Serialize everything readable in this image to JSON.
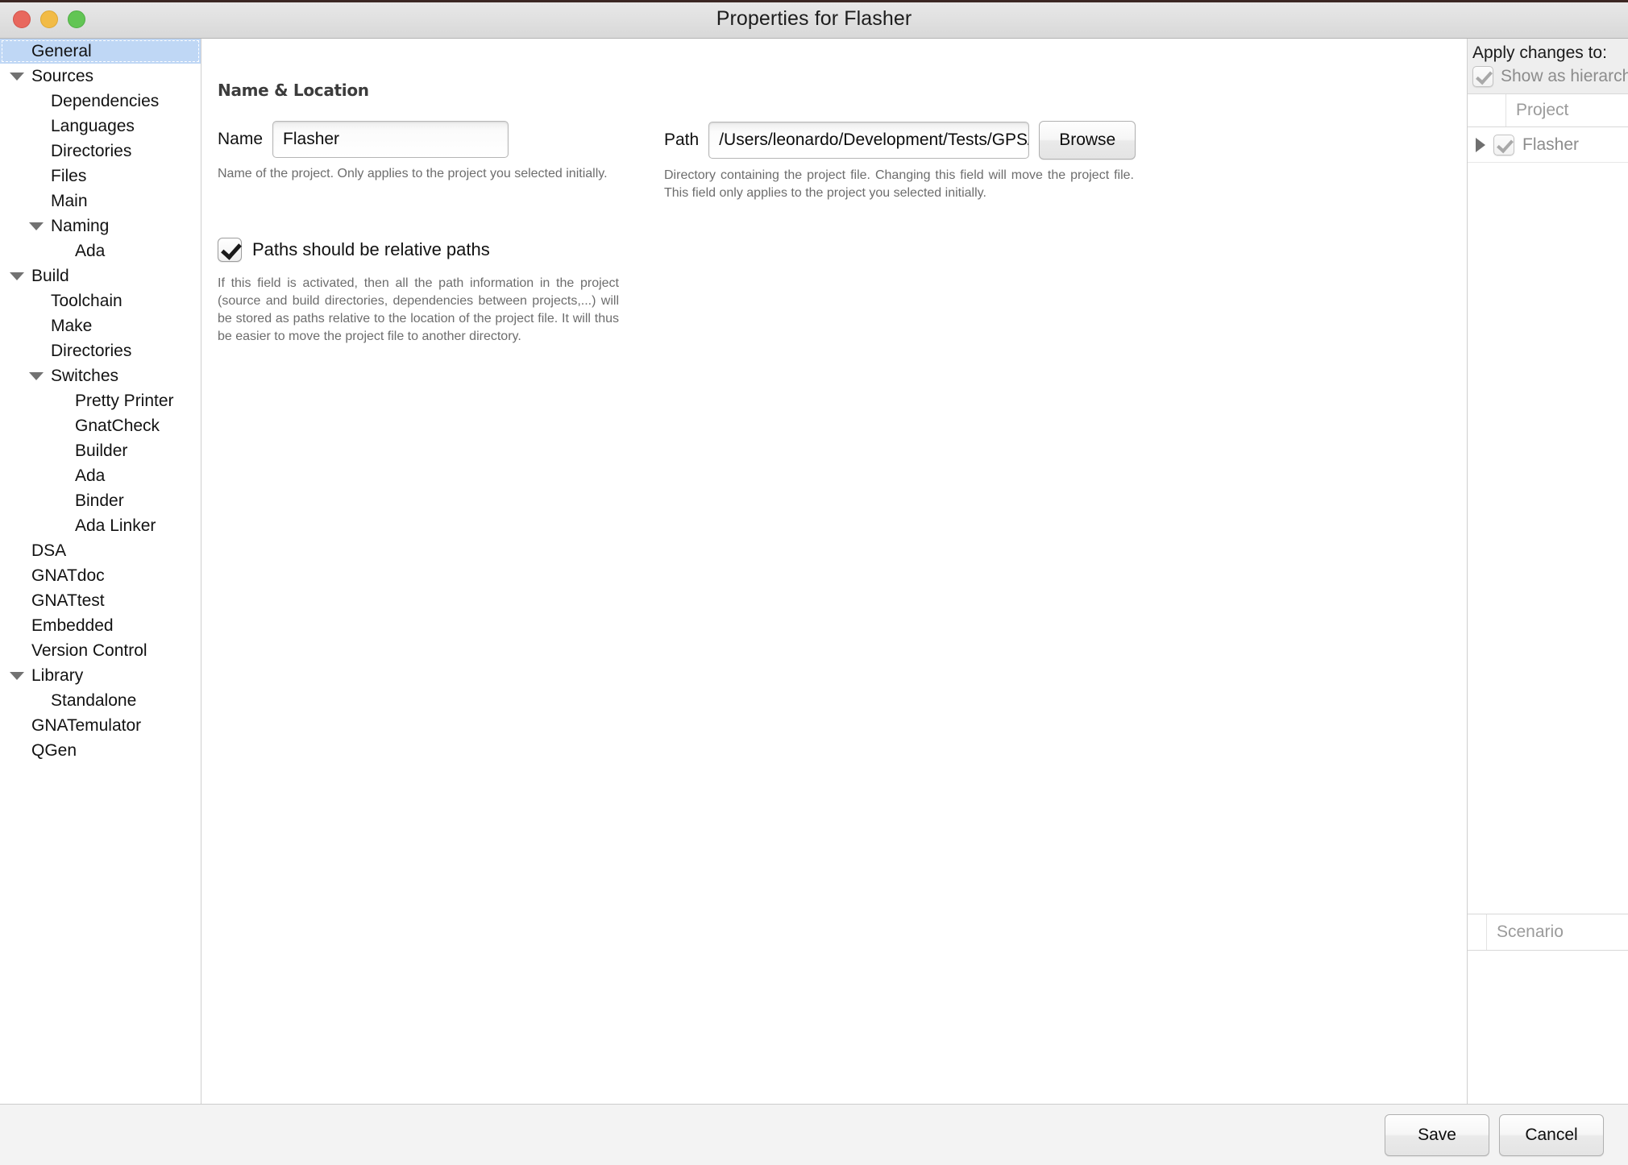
{
  "window": {
    "title": "Properties for Flasher",
    "traffic_lights": [
      "close",
      "minimize",
      "maximize"
    ]
  },
  "sidebar": {
    "items": [
      {
        "label": "General",
        "level": 0,
        "twisty": "none",
        "selected": true
      },
      {
        "label": "Sources",
        "level": 0,
        "twisty": "expanded",
        "selected": false
      },
      {
        "label": "Dependencies",
        "level": 1,
        "twisty": "none",
        "selected": false
      },
      {
        "label": "Languages",
        "level": 1,
        "twisty": "none",
        "selected": false
      },
      {
        "label": "Directories",
        "level": 1,
        "twisty": "none",
        "selected": false
      },
      {
        "label": "Files",
        "level": 1,
        "twisty": "none",
        "selected": false
      },
      {
        "label": "Main",
        "level": 1,
        "twisty": "none",
        "selected": false
      },
      {
        "label": "Naming",
        "level": 1,
        "twisty": "expanded",
        "selected": false
      },
      {
        "label": "Ada",
        "level": 2,
        "twisty": "none",
        "selected": false
      },
      {
        "label": "Build",
        "level": 0,
        "twisty": "expanded",
        "selected": false
      },
      {
        "label": "Toolchain",
        "level": 1,
        "twisty": "none",
        "selected": false
      },
      {
        "label": "Make",
        "level": 1,
        "twisty": "none",
        "selected": false
      },
      {
        "label": "Directories",
        "level": 1,
        "twisty": "none",
        "selected": false
      },
      {
        "label": "Switches",
        "level": 1,
        "twisty": "expanded",
        "selected": false
      },
      {
        "label": "Pretty Printer",
        "level": 2,
        "twisty": "none",
        "selected": false
      },
      {
        "label": "GnatCheck",
        "level": 2,
        "twisty": "none",
        "selected": false
      },
      {
        "label": "Builder",
        "level": 2,
        "twisty": "none",
        "selected": false
      },
      {
        "label": "Ada",
        "level": 2,
        "twisty": "none",
        "selected": false
      },
      {
        "label": "Binder",
        "level": 2,
        "twisty": "none",
        "selected": false
      },
      {
        "label": "Ada Linker",
        "level": 2,
        "twisty": "none",
        "selected": false
      },
      {
        "label": "DSA",
        "level": 0,
        "twisty": "none",
        "selected": false
      },
      {
        "label": "GNATdoc",
        "level": 0,
        "twisty": "none",
        "selected": false
      },
      {
        "label": "GNATtest",
        "level": 0,
        "twisty": "none",
        "selected": false
      },
      {
        "label": "Embedded",
        "level": 0,
        "twisty": "none",
        "selected": false
      },
      {
        "label": "Version Control",
        "level": 0,
        "twisty": "none",
        "selected": false
      },
      {
        "label": "Library",
        "level": 0,
        "twisty": "expanded",
        "selected": false
      },
      {
        "label": "Standalone",
        "level": 1,
        "twisty": "none",
        "selected": false
      },
      {
        "label": "GNATemulator",
        "level": 0,
        "twisty": "none",
        "selected": false
      },
      {
        "label": "QGen",
        "level": 0,
        "twisty": "none",
        "selected": false
      }
    ]
  },
  "main": {
    "section_title": "Name & Location",
    "name_field": {
      "label": "Name",
      "value": "Flasher",
      "hint": "Name of the project. Only applies to the project you selected initially."
    },
    "path_field": {
      "label": "Path",
      "value": "/Users/leonardo/Development/Tests/GPS/Lé",
      "browse_label": "Browse",
      "hint": "Directory containing the project file. Changing this field will move the project file. This field only applies to the project you selected initially."
    },
    "relative_paths": {
      "label": "Paths should be relative paths",
      "checked": true,
      "description": "If this field is activated, then all the path information in the project (source and build directories, dependencies between projects,...) will be stored as paths relative to the location of the project file. It will thus be easier to move the project file to another directory."
    }
  },
  "right_panel": {
    "apply_changes_title": "Apply changes to:",
    "show_as_hierarchy": {
      "label": "Show as hierarchy",
      "checked": true,
      "disabled": true
    },
    "project_column_header": "Project",
    "project_rows": [
      {
        "name": "Flasher",
        "checked": true,
        "expandable": true
      }
    ],
    "scenario_column_header": "Scenario"
  },
  "footer": {
    "save_label": "Save",
    "cancel_label": "Cancel"
  },
  "colors": {
    "selection_blue": "#bfd7f5",
    "titlebar_top": "#e9e9e9",
    "close_red": "#e8685e",
    "minimize_yellow": "#f2bb46",
    "maximize_green": "#62c554",
    "muted_text": "#8c8c8c"
  }
}
